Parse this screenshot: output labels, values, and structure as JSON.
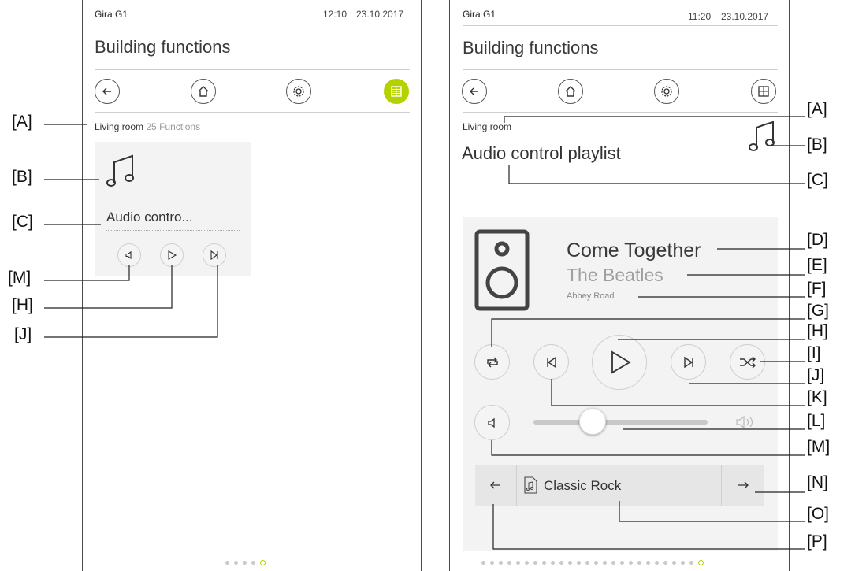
{
  "left": {
    "device": "Gira G1",
    "time": "12:10",
    "date": "23.10.2017",
    "title": "Building functions",
    "room": "Living room",
    "count": "25",
    "functions_label": "Functions",
    "tile_label": "Audio contro..."
  },
  "right": {
    "device": "Gira G1",
    "time": "11:20",
    "date": "23.10.2017",
    "title": "Building functions",
    "room": "Living room",
    "function_title": "Audio control playlist",
    "song": "Come Together",
    "artist": "The Beatles",
    "album": "Abbey Road",
    "playlist": "Classic Rock",
    "volume_level": 0.34
  },
  "labels": {
    "A": "[A]",
    "B": "[B]",
    "C": "[C]",
    "D": "[D]",
    "E": "[E]",
    "F": "[F]",
    "G": "[G]",
    "H": "[H]",
    "I": "[I]",
    "J": "[J]",
    "K": "[K]",
    "L": "[L]",
    "M": "[M]",
    "N": "[N]",
    "O": "[O]",
    "P": "[P]"
  },
  "colors": {
    "accent": "#b5d200",
    "panel": "#f3f3f3",
    "text": "#3c3c3c",
    "muted": "#9a9a9a"
  }
}
